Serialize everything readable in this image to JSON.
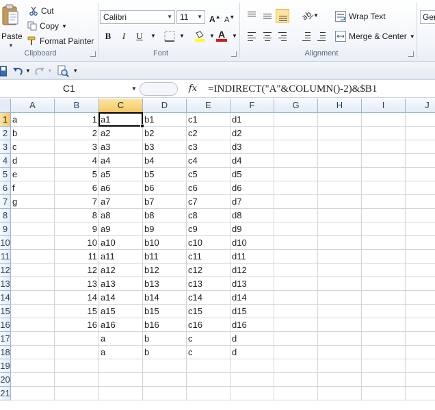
{
  "ribbon": {
    "clipboard": {
      "paste_label": "Paste",
      "cut_label": "Cut",
      "copy_label": "Copy",
      "format_painter_label": "Format Painter",
      "group_label": "Clipboard"
    },
    "font": {
      "font_name": "Calibri",
      "font_size": "11",
      "bold": "B",
      "italic": "I",
      "underline": "U",
      "font_color_letter": "A",
      "group_label": "Font"
    },
    "alignment": {
      "wrap_text_label": "Wrap Text",
      "merge_center_label": "Merge & Center",
      "group_label": "Alignment"
    },
    "number": {
      "format_value": "Ger"
    }
  },
  "formula_bar": {
    "name_box": "C1",
    "fx": "fx",
    "formula": "=INDIRECT(\"A\"&COLUMN()-2)&$B1"
  },
  "grid": {
    "columns": [
      "A",
      "B",
      "C",
      "D",
      "E",
      "F",
      "G",
      "H",
      "I",
      "J"
    ],
    "rows": [
      "1",
      "2",
      "3",
      "4",
      "5",
      "6",
      "7",
      "8",
      "9",
      "10",
      "11",
      "12",
      "13",
      "14",
      "15",
      "16",
      "17",
      "18",
      "19",
      "20",
      "21"
    ],
    "selected_column": "C",
    "selected_row": "1",
    "cells": {
      "A": [
        "a",
        "b",
        "c",
        "d",
        "e",
        "f",
        "g",
        "",
        "",
        "",
        "",
        "",
        "",
        "",
        "",
        "",
        "",
        "",
        "",
        "",
        ""
      ],
      "B": [
        "1",
        "2",
        "3",
        "4",
        "5",
        "6",
        "7",
        "8",
        "9",
        "10",
        "11",
        "12",
        "13",
        "14",
        "15",
        "16",
        "",
        "",
        "",
        "",
        ""
      ],
      "C": [
        "a1",
        "a2",
        "a3",
        "a4",
        "a5",
        "a6",
        "a7",
        "a8",
        "a9",
        "a10",
        "a11",
        "a12",
        "a13",
        "a14",
        "a15",
        "a16",
        "a",
        "a",
        "",
        "",
        ""
      ],
      "D": [
        "b1",
        "b2",
        "b3",
        "b4",
        "b5",
        "b6",
        "b7",
        "b8",
        "b9",
        "b10",
        "b11",
        "b12",
        "b13",
        "b14",
        "b15",
        "b16",
        "b",
        "b",
        "",
        "",
        ""
      ],
      "E": [
        "c1",
        "c2",
        "c3",
        "c4",
        "c5",
        "c6",
        "c7",
        "c8",
        "c9",
        "c10",
        "c11",
        "c12",
        "c13",
        "c14",
        "c15",
        "c16",
        "c",
        "c",
        "",
        "",
        ""
      ],
      "F": [
        "d1",
        "d2",
        "d3",
        "d4",
        "d5",
        "d6",
        "d7",
        "d8",
        "d9",
        "d10",
        "d11",
        "d12",
        "d13",
        "d14",
        "d15",
        "d16",
        "d",
        "d",
        "",
        "",
        ""
      ],
      "G": [],
      "H": [],
      "I": [],
      "J": []
    }
  },
  "colors": {
    "selection_header": "#f5c862",
    "header_text": "#27415f",
    "gridline": "#d4d4d4",
    "active_border": "#000000"
  }
}
